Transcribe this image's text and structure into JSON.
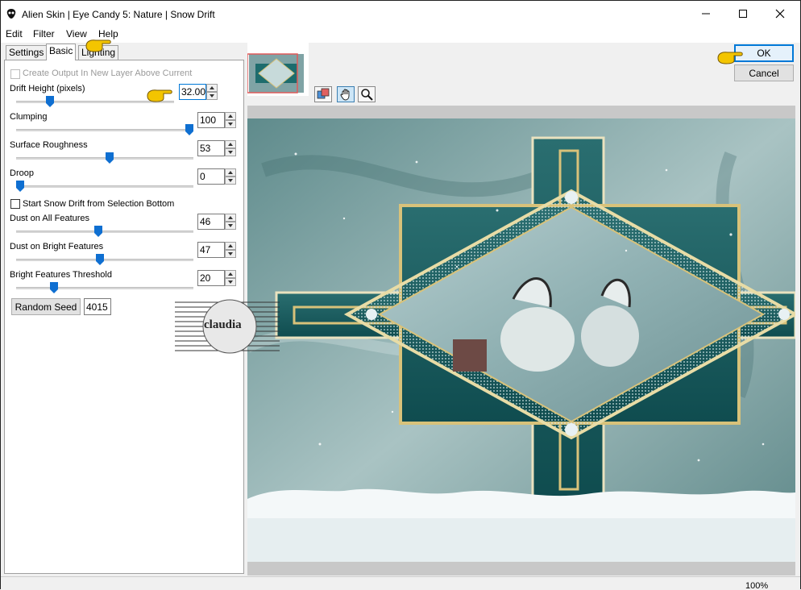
{
  "window": {
    "title": "Alien Skin | Eye Candy 5: Nature | Snow Drift"
  },
  "menu": [
    {
      "label": "Edit"
    },
    {
      "label": "Filter"
    },
    {
      "label": "View"
    },
    {
      "label": "Help"
    }
  ],
  "tabs": [
    {
      "label": "Settings",
      "active": false
    },
    {
      "label": "Basic",
      "active": true
    },
    {
      "label": "Lighting",
      "active": false
    }
  ],
  "basic": {
    "create_output_label": "Create Output In New Layer Above Current",
    "drift_height": {
      "label": "Drift Height (pixels)",
      "value": "32.00",
      "fraction": 0.2
    },
    "clumping": {
      "label": "Clumping",
      "value": "100",
      "fraction": 1.0
    },
    "surface_roughness": {
      "label": "Surface Roughness",
      "value": "53",
      "fraction": 0.53
    },
    "droop": {
      "label": "Droop",
      "value": "0",
      "fraction": 0.0
    },
    "start_snow_label": "Start Snow Drift from Selection Bottom",
    "dust_all": {
      "label": "Dust on All Features",
      "value": "46",
      "fraction": 0.46
    },
    "dust_bright": {
      "label": "Dust on Bright Features",
      "value": "47",
      "fraction": 0.47
    },
    "bright_threshold": {
      "label": "Bright Features Threshold",
      "value": "20",
      "fraction": 0.2
    },
    "random_seed_label": "Random Seed",
    "random_seed_value": "4015"
  },
  "buttons": {
    "ok": "OK",
    "cancel": "Cancel"
  },
  "watermark": {
    "text": "claudia"
  },
  "status": {
    "zoom": "100%"
  },
  "colors": {
    "accent": "#0078d7",
    "teal": "#2f7b7a",
    "gold": "#d8c27a",
    "pointer": "#f3c500"
  }
}
